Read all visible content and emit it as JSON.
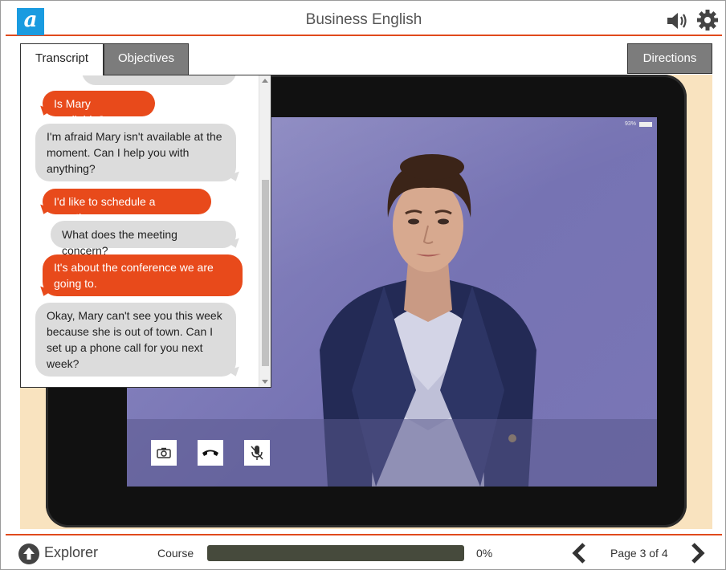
{
  "header": {
    "logo_letter": "a",
    "title": "Business English"
  },
  "tabs": {
    "transcript": "Transcript",
    "objectives": "Objectives",
    "directions": "Directions"
  },
  "device": {
    "battery": "93%"
  },
  "transcript": {
    "messages": [
      {
        "speaker": "bot",
        "text": ""
      },
      {
        "speaker": "user",
        "text": "Is Mary available?"
      },
      {
        "speaker": "bot",
        "text": "I'm afraid Mary isn't available at the moment. Can I help you with anything?"
      },
      {
        "speaker": "user",
        "text": "I'd like to schedule a meeting."
      },
      {
        "speaker": "bot",
        "text": "What does the meeting concern?"
      },
      {
        "speaker": "user",
        "text": "It's about the conference we are going to."
      },
      {
        "speaker": "bot",
        "text": "Okay, Mary can't see you this week because she is out of town. Can I set up a phone call for you next week?"
      }
    ]
  },
  "footer": {
    "explorer_label": "Explorer",
    "course_label": "Course",
    "progress_text": "0%",
    "progress_fraction": 0,
    "page_label": "Page 3 of 4"
  },
  "colors": {
    "accent": "#e04a1c",
    "user_bubble": "#e84a1b",
    "bot_bubble": "#dcdcdc",
    "logo": "#1a9be0"
  },
  "icons": {
    "speaker": "speaker-icon",
    "settings": "gear-icon",
    "camera": "camera-icon",
    "hangup": "phone-hangup-icon",
    "mute": "microphone-mute-icon",
    "explorer": "arrow-up-circle-icon",
    "prev": "chevron-left-icon",
    "next": "chevron-right-icon"
  }
}
